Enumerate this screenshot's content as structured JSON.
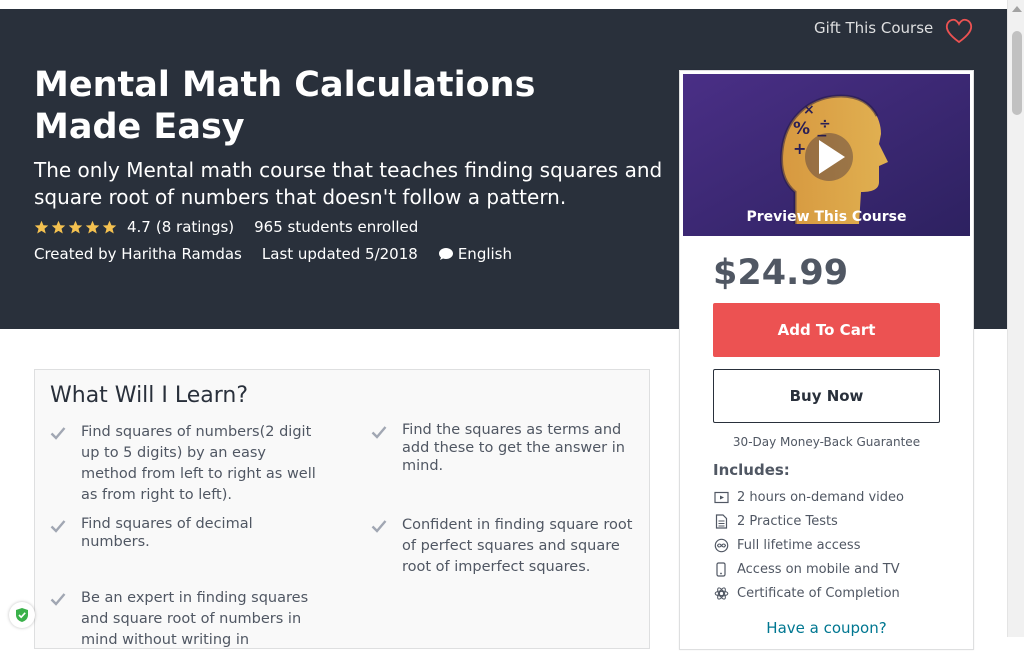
{
  "header": {
    "gift_label": "Gift This Course"
  },
  "course": {
    "title": "Mental Math Calculations Made Easy",
    "subtitle": "The only Mental math course that teaches finding squares and square root of numbers that doesn't follow a pattern.",
    "rating_value": "4.7",
    "rating_count": "(8 ratings)",
    "stars": 5,
    "enrolled": "965 students enrolled",
    "created_by": "Created by Haritha Ramdas",
    "last_updated": "Last updated 5/2018",
    "language": "English"
  },
  "sidebar": {
    "preview_label": "Preview This Course",
    "price": "$24.99",
    "add_to_cart": "Add To Cart",
    "buy_now": "Buy Now",
    "guarantee": "30-Day Money-Back Guarantee",
    "includes_title": "Includes:",
    "includes": [
      {
        "icon": "video-icon",
        "label": "2 hours on-demand video"
      },
      {
        "icon": "document-icon",
        "label": "2 Practice Tests"
      },
      {
        "icon": "infinity-icon",
        "label": "Full lifetime access"
      },
      {
        "icon": "mobile-icon",
        "label": "Access on mobile and TV"
      },
      {
        "icon": "certificate-icon",
        "label": "Certificate of Completion"
      }
    ],
    "coupon": "Have a coupon?"
  },
  "learn": {
    "title": "What Will I Learn?",
    "items": [
      "Find squares of numbers(2 digit up to 5 digits) by an easy method from left to right as well as from right to left).",
      "Find the squares as terms and add these to get the answer in mind.",
      "Find squares of decimal numbers.",
      "Confident in finding square root of perfect squares and square root of imperfect squares.",
      "Be an expert in finding squares and square root of numbers in mind without writing in"
    ]
  },
  "colors": {
    "hero_bg": "#29303b",
    "cart_button": "#ec5252",
    "link": "#007791",
    "star": "#f4c150"
  }
}
